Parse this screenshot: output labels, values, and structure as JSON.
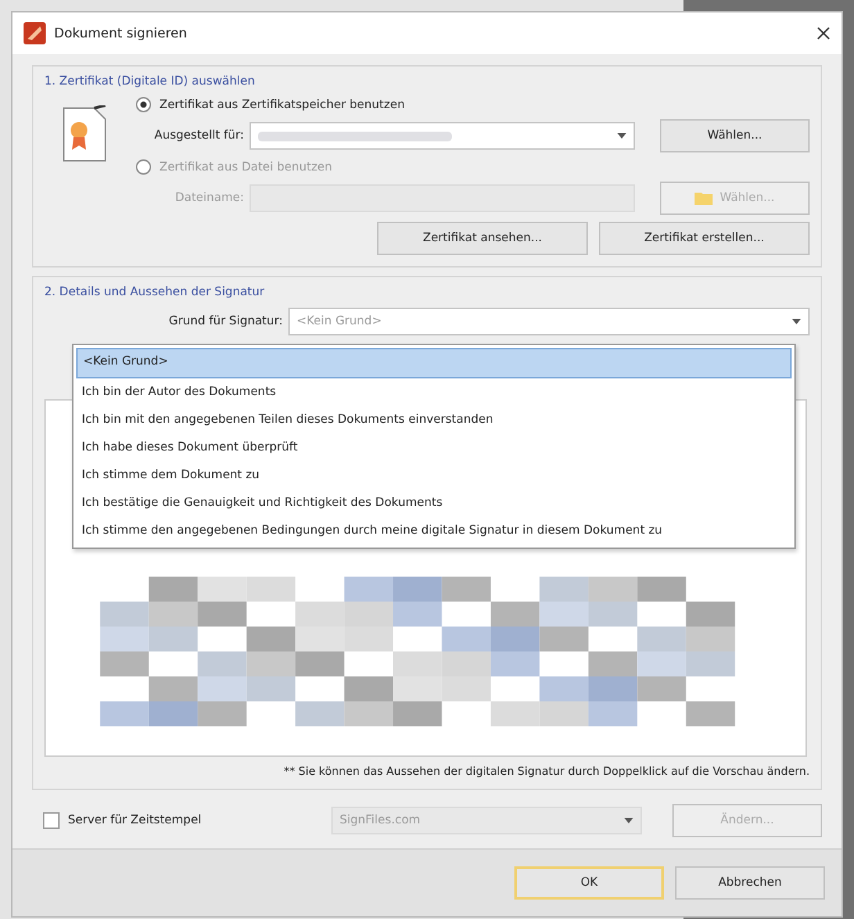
{
  "window": {
    "title": "Dokument signieren"
  },
  "certificate_section": {
    "title": "1. Zertifikat (Digitale ID) auswählen",
    "options": [
      {
        "label": "Zertifikat aus Zertifikatspeicher benutzen",
        "selected": true,
        "field_label": "Ausgestellt für:",
        "kind": "dropdown",
        "button": "Wählen...",
        "disabled": false
      },
      {
        "label": "Zertifikat aus Datei benutzen",
        "selected": false,
        "field_label": "Dateiname:",
        "kind": "text",
        "button": "Wählen...",
        "disabled": true
      }
    ],
    "buttons": [
      "Zertifikat ansehen...",
      "Zertifikat erstellen..."
    ]
  },
  "signature_section": {
    "title": "2. Details und Aussehen der Signatur",
    "reason_label": "Grund für Signatur:",
    "reason_value": "<Kein Grund>",
    "reason_options": [
      {
        "label": "<Kein Grund>",
        "selected": true
      },
      {
        "label": "Ich bin der Autor des Dokuments",
        "selected": false
      },
      {
        "label": "Ich bin mit den angegebenen Teilen dieses Dokuments einverstanden",
        "selected": false
      },
      {
        "label": "Ich habe dieses Dokument überprüft",
        "selected": false
      },
      {
        "label": "Ich stimme dem Dokument zu",
        "selected": false
      },
      {
        "label": "Ich bestätige die Genauigkeit und Richtigkeit des Dokuments",
        "selected": false
      },
      {
        "label": "Ich stimme den angegebenen Bedingungen durch meine digitale Signatur in diesem Dokument zu",
        "selected": false
      }
    ],
    "note": "** Sie können das Aussehen der digitalen Signatur durch Doppelklick auf die Vorschau ändern."
  },
  "timestamp": {
    "label": "Server für Zeitstempel",
    "checked": false,
    "server": "SignFiles.com",
    "button": "Ändern...",
    "disabled": true
  },
  "buttons": [
    {
      "label": "OK",
      "default": true
    },
    {
      "label": "Abbrechen",
      "default": false
    }
  ]
}
